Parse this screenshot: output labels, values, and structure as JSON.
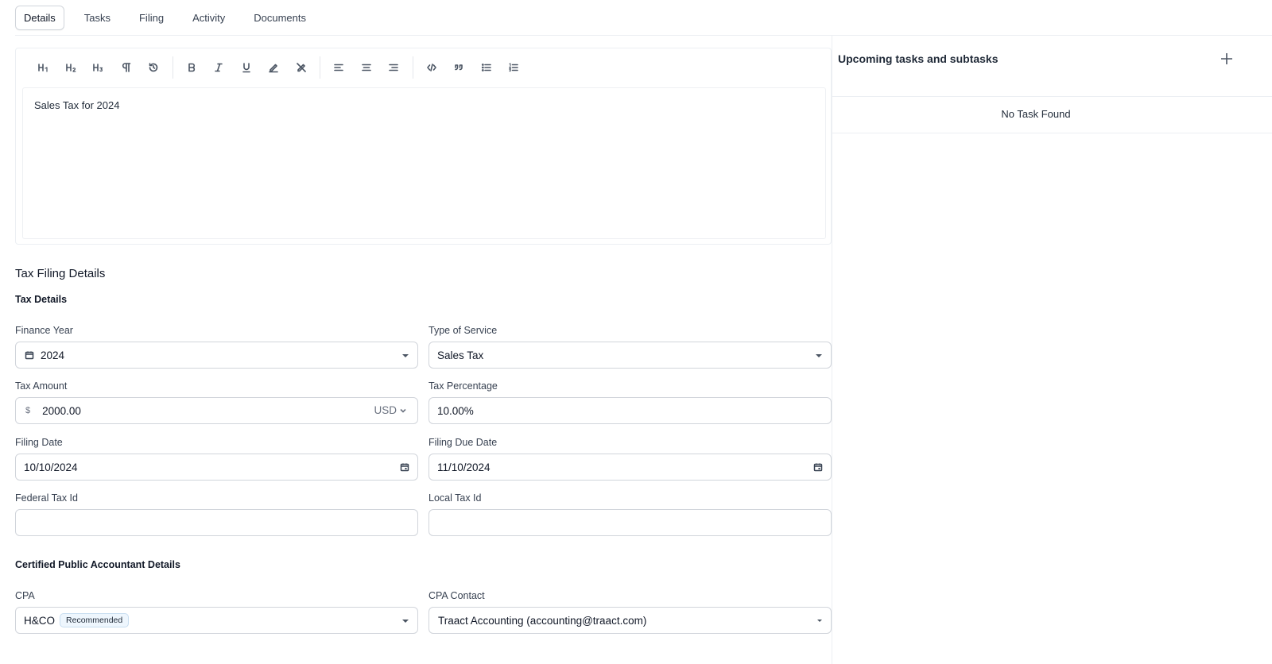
{
  "tabs": [
    {
      "label": "Details",
      "active": true
    },
    {
      "label": "Tasks",
      "active": false
    },
    {
      "label": "Filing",
      "active": false
    },
    {
      "label": "Activity",
      "active": false
    },
    {
      "label": "Documents",
      "active": false
    }
  ],
  "editor": {
    "content": "Sales Tax for 2024",
    "toolbar": [
      "heading-1",
      "heading-2",
      "heading-3",
      "paragraph",
      "undo",
      "bold",
      "italic",
      "underline",
      "highlight",
      "clear-format",
      "align-left",
      "align-center",
      "align-right",
      "code",
      "blockquote",
      "bullet-list",
      "ordered-list"
    ]
  },
  "side_panel": {
    "title": "Upcoming tasks and subtasks",
    "empty_text": "No Task Found"
  },
  "form": {
    "section_title": "Tax Filing Details",
    "tax_details_title": "Tax Details",
    "finance_year": {
      "label": "Finance Year",
      "value": "2024"
    },
    "type_of_service": {
      "label": "Type of Service",
      "value": "Sales Tax"
    },
    "tax_amount": {
      "label": "Tax Amount",
      "prefix": "$",
      "value": "2000.00",
      "currency": "USD"
    },
    "tax_percentage": {
      "label": "Tax Percentage",
      "value": "10.00%"
    },
    "filing_date": {
      "label": "Filing Date",
      "value": "10/10/2024"
    },
    "filing_due_date": {
      "label": "Filing Due Date",
      "value": "11/10/2024"
    },
    "federal_tax_id": {
      "label": "Federal Tax Id",
      "value": ""
    },
    "local_tax_id": {
      "label": "Local Tax Id",
      "value": ""
    },
    "cpa_title": "Certified Public Accountant Details",
    "cpa": {
      "label": "CPA",
      "value": "H&CO",
      "badge": "Recommended"
    },
    "cpa_contact": {
      "label": "CPA Contact",
      "value": "Traact Accounting (accounting@traact.com)"
    }
  },
  "colors": {
    "border": "#d1d5db",
    "divider": "#eceff3",
    "badge_bg": "#eef6fd",
    "badge_border": "#c7ddf0"
  }
}
